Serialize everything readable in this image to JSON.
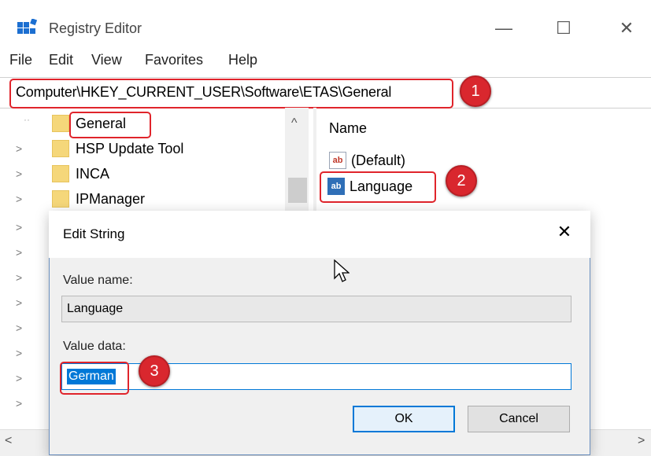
{
  "window": {
    "title": "Registry Editor",
    "controls": {
      "minimize": "—",
      "maximize": "☐",
      "close": "✕"
    }
  },
  "menu": [
    "File",
    "Edit",
    "View",
    "Favorites",
    "Help"
  ],
  "address": {
    "path": "Computer\\HKEY_CURRENT_USER\\Software\\ETAS\\General"
  },
  "tree": {
    "items": [
      {
        "label": "General",
        "selected": true
      },
      {
        "label": "HSP Update Tool"
      },
      {
        "label": "INCA"
      },
      {
        "label": "IPManager"
      }
    ],
    "scroll_up": "^"
  },
  "values_pane": {
    "column_name": "Name",
    "items": [
      {
        "name": "(Default)",
        "icon": "string-value-icon"
      },
      {
        "name": "Language",
        "icon": "string-value-icon",
        "selected": true
      }
    ]
  },
  "dialog": {
    "title": "Edit String",
    "value_name_label": "Value name:",
    "value_name": "Language",
    "value_data_label": "Value data:",
    "value_data": "German",
    "ok_label": "OK",
    "cancel_label": "Cancel"
  },
  "annotations": [
    "1",
    "2",
    "3"
  ],
  "scrollbar": {
    "left": "<",
    "right": ">"
  },
  "colors": {
    "annotation_red": "#e0242b",
    "selection_blue": "#0078d7",
    "folder_yellow": "#f5d77a"
  }
}
